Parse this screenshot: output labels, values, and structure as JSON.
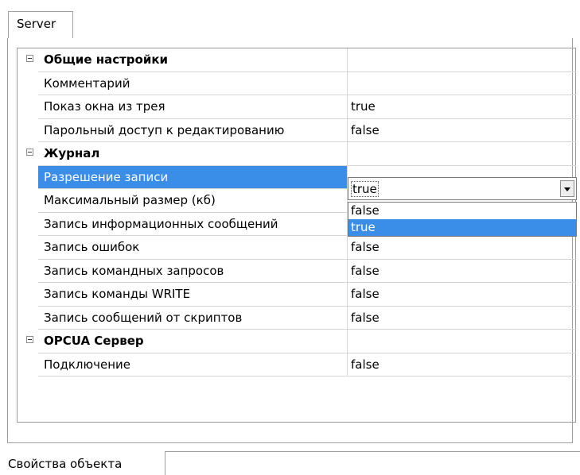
{
  "top_tab": {
    "label": "Server"
  },
  "bottom_tab": {
    "label": "Свойства объекта"
  },
  "grid": {
    "rows": [
      {
        "type": "category",
        "name": "Общие настройки",
        "value": ""
      },
      {
        "type": "property",
        "name": "Комментарий",
        "value": ""
      },
      {
        "type": "property",
        "name": "Показ окна из трея",
        "value": "true"
      },
      {
        "type": "property",
        "name": "Парольный доступ к редактированию",
        "value": "false"
      },
      {
        "type": "category",
        "name": "Журнал",
        "value": ""
      },
      {
        "type": "property",
        "name": "Разрешение записи",
        "value": "true",
        "selected": true
      },
      {
        "type": "property",
        "name": "Максимальный размер (кб)",
        "value": ""
      },
      {
        "type": "property",
        "name": "Запись информационных сообщений",
        "value": "false"
      },
      {
        "type": "property",
        "name": "Запись ошибок",
        "value": "false"
      },
      {
        "type": "property",
        "name": "Запись командных запросов",
        "value": "false"
      },
      {
        "type": "property",
        "name": "Запись команды WRITE",
        "value": "false"
      },
      {
        "type": "property",
        "name": "Запись сообщений от скриптов",
        "value": "false"
      },
      {
        "type": "category",
        "name": "OPCUA Сервер",
        "value": ""
      },
      {
        "type": "property",
        "name": "Подключение",
        "value": "false"
      }
    ]
  },
  "combo": {
    "value": "true",
    "options": [
      "false",
      "true"
    ],
    "highlighted": "true"
  },
  "colors": {
    "selection": "#3b8ee8",
    "border": "#a0a0a0"
  }
}
